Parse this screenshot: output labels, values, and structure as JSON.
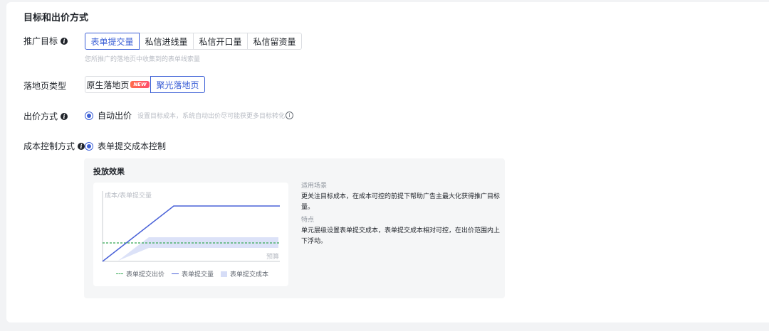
{
  "section": {
    "title": "目标和出价方式"
  },
  "promotion_goal": {
    "label": "推广目标",
    "options": [
      "表单提交量",
      "私信进线量",
      "私信开口量",
      "私信留资量"
    ],
    "selected": 0,
    "hint": "您所推广的落地页中收集到的表单线索量"
  },
  "landing_type": {
    "label": "落地页类型",
    "options": [
      "原生落地页",
      "聚光落地页"
    ],
    "new_badge": "NEW",
    "selected": 1
  },
  "bid_method": {
    "label": "出价方式",
    "option": "自动出价",
    "desc": "设置目标成本，系统自动出价尽可能获更多目标转化"
  },
  "cost_control": {
    "label": "成本控制方式",
    "option": "表单提交成本控制"
  },
  "effect_panel": {
    "title": "投放效果",
    "chart_ylabel": "成本/表单提交量",
    "chart_xlabel": "预算",
    "legend": [
      "表单提交出价",
      "表单提交量",
      "表单提交成本"
    ],
    "scene_label": "适用场景",
    "scene_text": "更关注目标成本，在成本可控的前提下帮助广告主最大化获得推广目标量。",
    "feature_label": "特点",
    "feature_text": "单元层级设置表单提交成本，表单提交成本相对可控，在出价范围内上下浮动。"
  },
  "colors": {
    "accent": "#3b5fd6",
    "line": "#4a62d8",
    "bid": "#34a853",
    "band": "#d6ddf7"
  }
}
